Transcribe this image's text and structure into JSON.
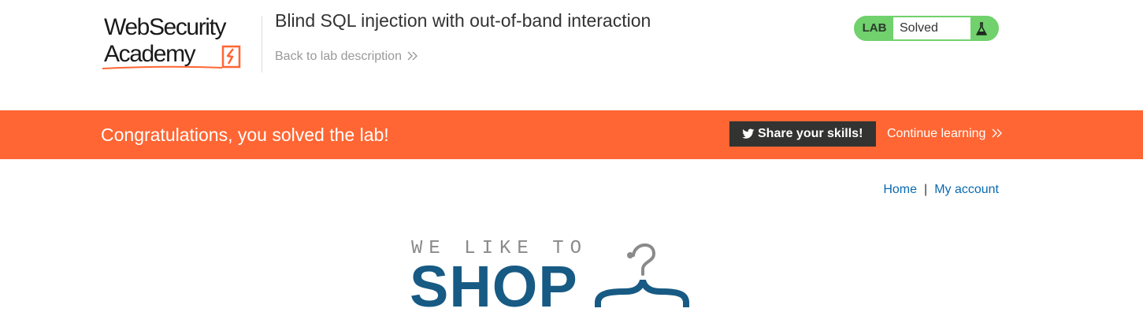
{
  "header": {
    "logo_line1": "WebSecurity",
    "logo_line2": "Academy",
    "lab_title": "Blind SQL injection with out-of-band interaction",
    "back_link": "Back to lab description"
  },
  "status": {
    "label": "LAB",
    "text": "Solved",
    "icon": "flask-icon",
    "color": "#70d16d"
  },
  "banner": {
    "message": "Congratulations, you solved the lab!",
    "share_label": "Share your skills!",
    "share_icon": "twitter-icon",
    "continue_label": "Continue learning",
    "color": "#ff6633"
  },
  "nav": {
    "home": "Home",
    "separator": "|",
    "account": "My account"
  },
  "shop_logo": {
    "tagline": "WE LIKE TO",
    "word": "SHOP",
    "icon": "hanger-icon",
    "color": "#175a84"
  }
}
